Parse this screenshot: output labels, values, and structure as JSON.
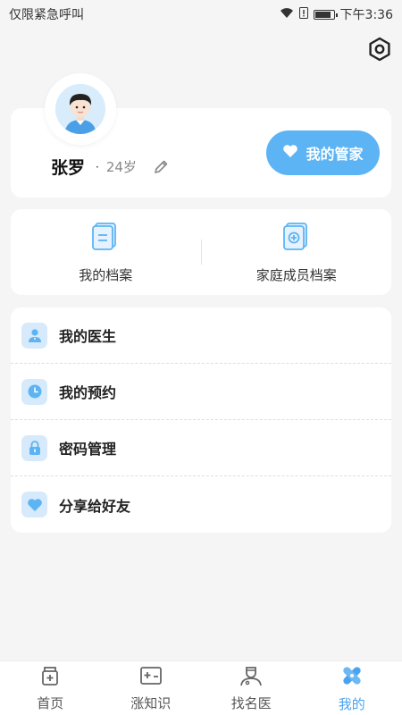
{
  "status_bar": {
    "carrier_text": "仅限紧急呼叫",
    "time": "下午3:36"
  },
  "profile": {
    "name": "张罗",
    "separator": "·",
    "age": "24岁",
    "butler_button": "我的管家"
  },
  "records": {
    "my_records": "我的档案",
    "family_records": "家庭成员档案"
  },
  "menu": {
    "items": [
      {
        "label": "我的医生",
        "icon": "doctor-icon"
      },
      {
        "label": "我的预约",
        "icon": "clock-icon"
      },
      {
        "label": "密码管理",
        "icon": "lock-icon"
      },
      {
        "label": "分享给好友",
        "icon": "heart-icon"
      }
    ]
  },
  "tabs": {
    "items": [
      {
        "label": "首页",
        "icon": "home-icon"
      },
      {
        "label": "涨知识",
        "icon": "knowledge-icon"
      },
      {
        "label": "找名医",
        "icon": "find-doctor-icon"
      },
      {
        "label": "我的",
        "icon": "mine-icon"
      }
    ],
    "active_index": 3
  },
  "colors": {
    "accent": "#5cb4f4",
    "icon_bg": "#d6eafc",
    "background": "#f5f5f5"
  }
}
